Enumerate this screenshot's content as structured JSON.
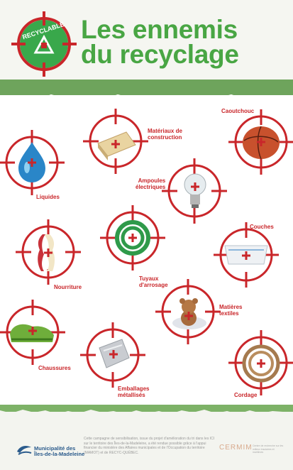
{
  "header": {
    "badge_text": "RECYCLABLE",
    "title_line1": "Les ennemis",
    "title_line2": "du recyclage"
  },
  "items": {
    "liquides": "Liquides",
    "materiaux_1": "Matériaux de",
    "materiaux_2": "construction",
    "caoutchouc": "Caoutchouc",
    "ampoules_1": "Ampoules",
    "ampoules_2": "électriques",
    "couches": "Couches",
    "nourriture": "Nourriture",
    "tuyaux_1": "Tuyaux",
    "tuyaux_2": "d'arrosage",
    "matieres_1": "Matières",
    "matieres_2": "textiles",
    "chaussures": "Chaussures",
    "emballages_1": "Emballages",
    "emballages_2": "métallisés",
    "cordage": "Cordage"
  },
  "footer": {
    "municipality_line1": "Municipalité des",
    "municipality_line2": "Îles-de-la-Madeleine",
    "campaign_text": "Cette campagne de sensibilisation, issue du projet d'amélioration du tri dans les ICI sur le territoire des Îles-de-la-Madeleine, a été rendue possible grâce à l'appui financier du ministère des Affaires municipales et de l'Occupation du territoire (MAMOT) et de RECYC-QUÉBEC.",
    "partner_name": "CERMIM",
    "partner_subtitle": "Centre de recherche sur les milieux insulaires et maritimes"
  },
  "colors": {
    "title_green": "#49a644",
    "target_red": "#c9262a",
    "band_green": "#6ea45c"
  }
}
